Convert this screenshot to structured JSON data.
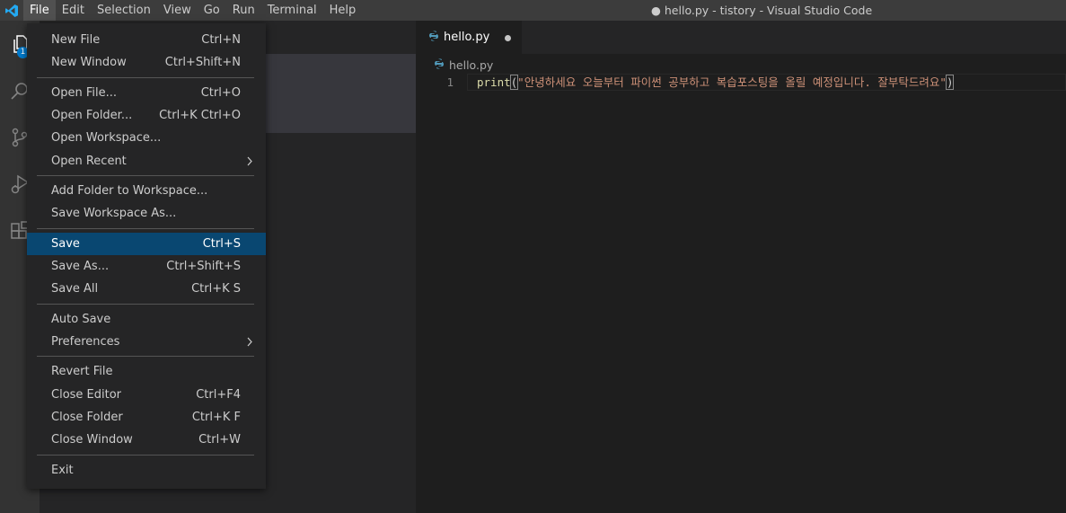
{
  "menubar": {
    "items": [
      "File",
      "Edit",
      "Selection",
      "View",
      "Go",
      "Run",
      "Terminal",
      "Help"
    ],
    "active": "File"
  },
  "window_title": "● hello.py - tistory - Visual Studio Code",
  "activitybar": {
    "explorer_badge": "1"
  },
  "editor": {
    "tab": {
      "label": "hello.py"
    },
    "breadcrumb": "hello.py",
    "line_number": "1",
    "code": {
      "fn": "print",
      "open_paren": "(",
      "string": "\"안녕하세요 오늘부터 파이썬 공부하고 복습포스팅을 올릴 예정입니다. 잘부탁드려요\"",
      "close_paren": ")"
    }
  },
  "file_menu": {
    "groups": [
      [
        {
          "label": "New File",
          "shortcut": "Ctrl+N"
        },
        {
          "label": "New Window",
          "shortcut": "Ctrl+Shift+N"
        }
      ],
      [
        {
          "label": "Open File...",
          "shortcut": "Ctrl+O"
        },
        {
          "label": "Open Folder...",
          "shortcut": "Ctrl+K Ctrl+O"
        },
        {
          "label": "Open Workspace...",
          "shortcut": ""
        },
        {
          "label": "Open Recent",
          "shortcut": "",
          "submenu": true
        }
      ],
      [
        {
          "label": "Add Folder to Workspace...",
          "shortcut": ""
        },
        {
          "label": "Save Workspace As...",
          "shortcut": ""
        }
      ],
      [
        {
          "label": "Save",
          "shortcut": "Ctrl+S",
          "highlighted": true
        },
        {
          "label": "Save As...",
          "shortcut": "Ctrl+Shift+S"
        },
        {
          "label": "Save All",
          "shortcut": "Ctrl+K S"
        }
      ],
      [
        {
          "label": "Auto Save",
          "shortcut": ""
        },
        {
          "label": "Preferences",
          "shortcut": "",
          "submenu": true
        }
      ],
      [
        {
          "label": "Revert File",
          "shortcut": ""
        },
        {
          "label": "Close Editor",
          "shortcut": "Ctrl+F4"
        },
        {
          "label": "Close Folder",
          "shortcut": "Ctrl+K F"
        },
        {
          "label": "Close Window",
          "shortcut": "Ctrl+W"
        }
      ],
      [
        {
          "label": "Exit",
          "shortcut": ""
        }
      ]
    ]
  },
  "colors": {
    "accent": "#007acc",
    "menu_highlight": "#094771",
    "logo": "#23a9f2",
    "python_icon": "#519aba"
  }
}
